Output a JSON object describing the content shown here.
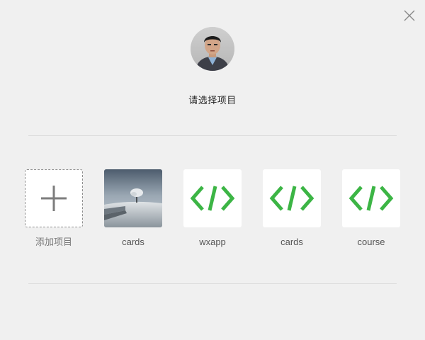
{
  "dialog": {
    "title": "请选择项目"
  },
  "projects": [
    {
      "label": "添加项目",
      "kind": "add"
    },
    {
      "label": "cards",
      "kind": "photo"
    },
    {
      "label": "wxapp",
      "kind": "code"
    },
    {
      "label": "cards",
      "kind": "code"
    },
    {
      "label": "course",
      "kind": "code"
    }
  ],
  "colors": {
    "background": "#f0f0f0",
    "code_icon": "#3cb545",
    "divider": "#dcdcdc",
    "add_icon": "#7d7d7d"
  },
  "icons": {
    "close": "close-icon",
    "add": "plus-icon",
    "code": "code-brackets-icon",
    "avatar": "user-avatar"
  }
}
